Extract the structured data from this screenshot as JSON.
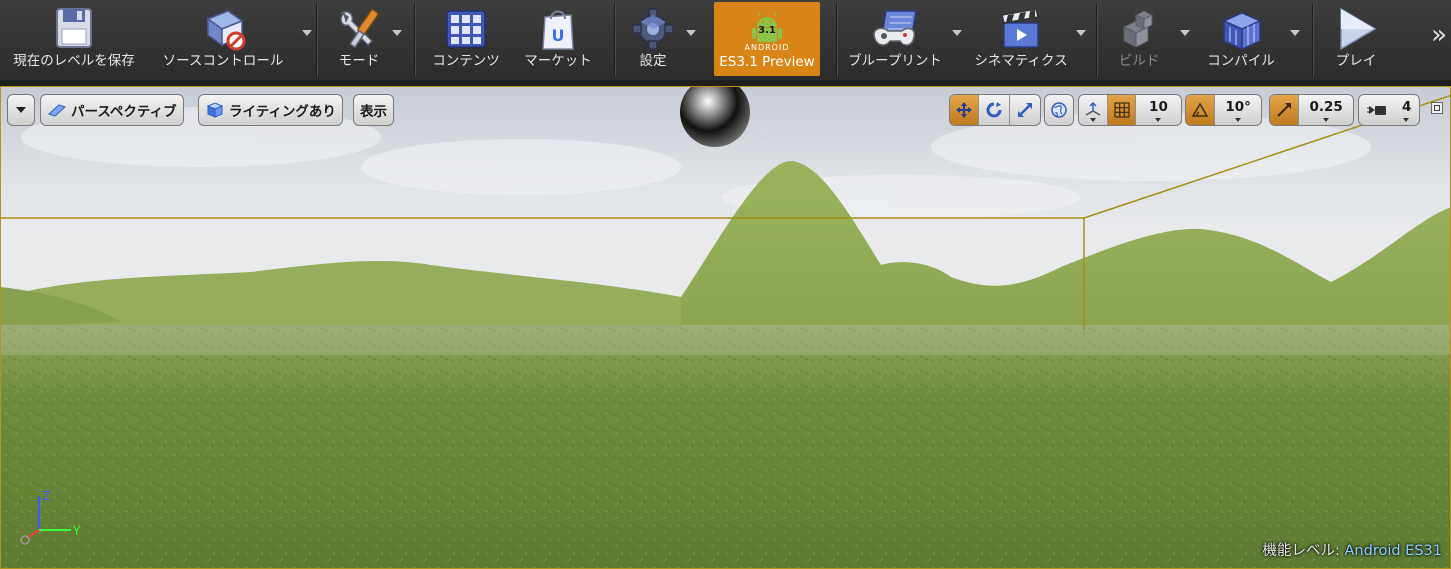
{
  "toolbar": {
    "save": "現在のレベルを保存",
    "source_control": "ソースコントロール",
    "modes": "モード",
    "content": "コンテンツ",
    "marketplace": "マーケット",
    "settings": "設定",
    "preview": "ES3.1 Preview",
    "preview_badge": "3.1",
    "preview_brand": "ANDROID",
    "blueprints": "ブループリント",
    "cinematics": "シネマティクス",
    "build": "ビルド",
    "compile": "コンパイル",
    "play": "プレイ",
    "more": "»"
  },
  "viewport": {
    "perspective": "パースペクティブ",
    "lighting": "ライティングあり",
    "show": "表示",
    "grid_snap": "10",
    "rotation_snap": "10°",
    "scale_snap": "0.25",
    "camera_speed": "4",
    "feature_level_label": "機能レベル:",
    "feature_level_value": "Android ES31",
    "axis": {
      "z": "Z",
      "y": "Y"
    }
  },
  "colors": {
    "accent": "#d88517",
    "selection": "#b8941c",
    "toolbar_bg": "#2c2c2c"
  }
}
